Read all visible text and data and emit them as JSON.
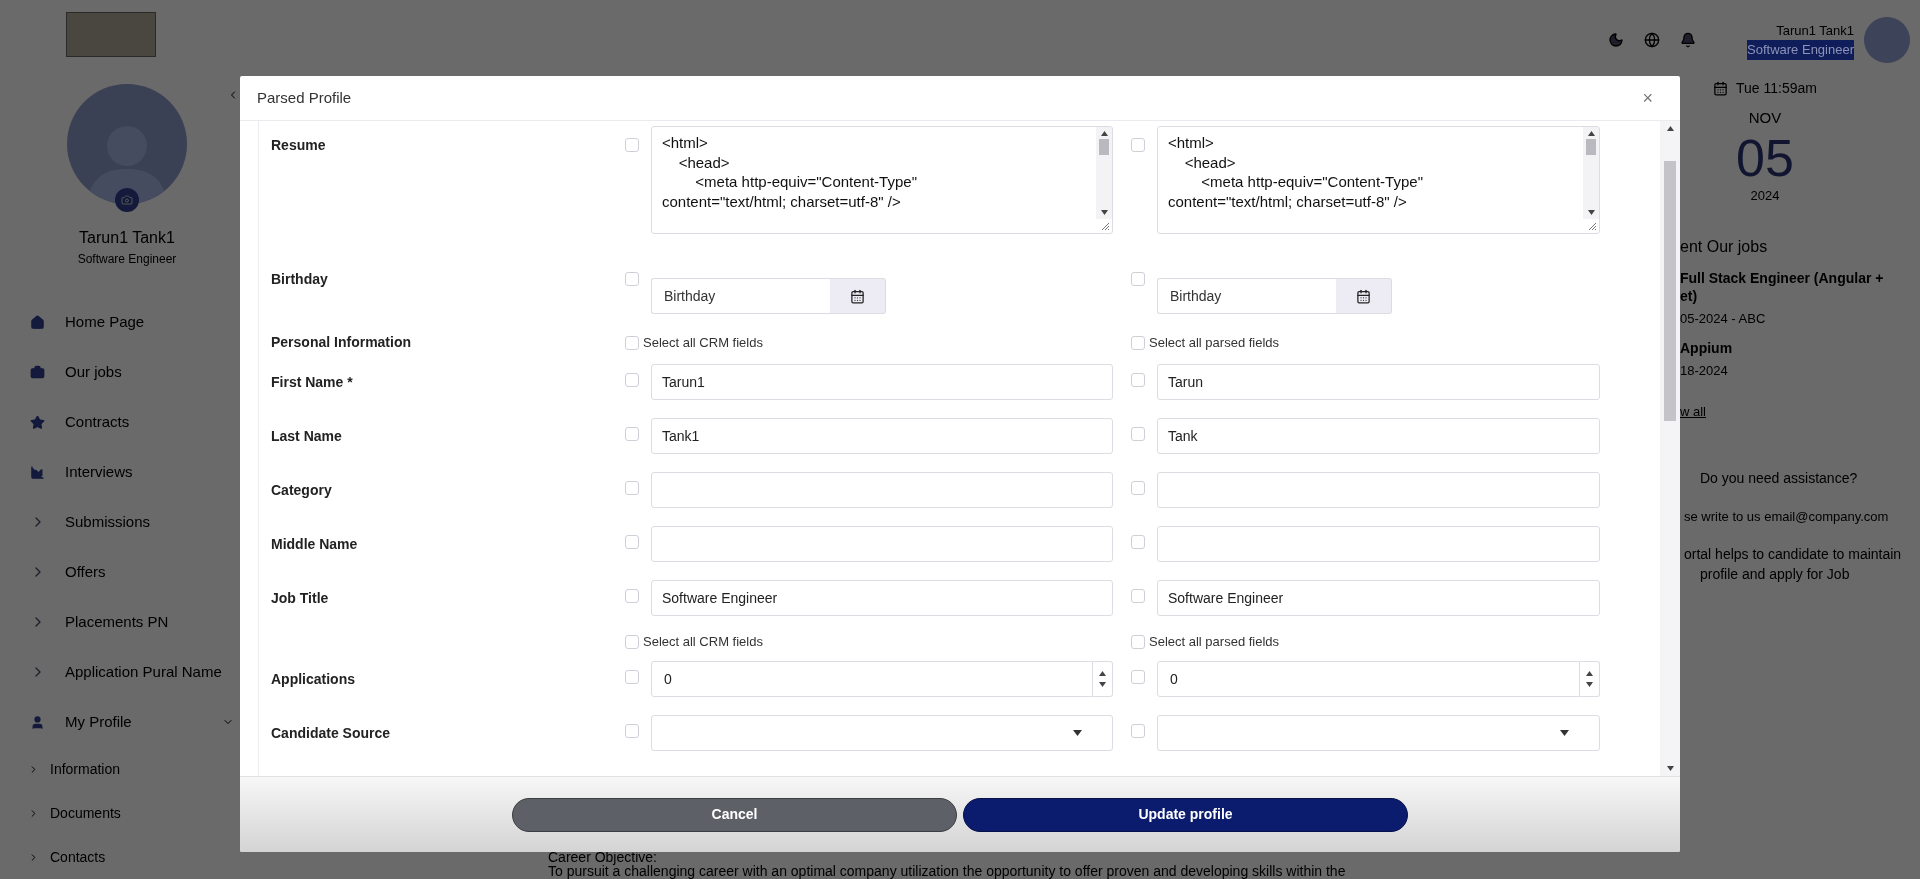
{
  "sidebar": {
    "user_name": "Tarun1 Tank1",
    "user_title": "Software Engineer",
    "items": [
      {
        "label": "Home Page",
        "kind": "link"
      },
      {
        "label": "Our jobs",
        "kind": "link"
      },
      {
        "label": "Contracts",
        "kind": "link"
      },
      {
        "label": "Interviews",
        "kind": "link"
      },
      {
        "label": "Submissions",
        "kind": "group",
        "expanded": false
      },
      {
        "label": "Offers",
        "kind": "group",
        "expanded": false
      },
      {
        "label": "Placements PN",
        "kind": "group",
        "expanded": false
      },
      {
        "label": "Application Pural Name",
        "kind": "group",
        "expanded": false
      },
      {
        "label": "My Profile",
        "kind": "section",
        "expanded": true,
        "children": [
          {
            "label": "Information"
          },
          {
            "label": "Documents"
          },
          {
            "label": "Contacts"
          }
        ]
      }
    ]
  },
  "topbar": {
    "user_name": "Tarun1 Tank1",
    "user_title": "Software Engineer",
    "title_highlighted": true
  },
  "date": {
    "time": "Tue 11:59am",
    "month": "NOV",
    "day": "05",
    "year": "2024"
  },
  "recent_jobs": {
    "heading": "ent Our jobs",
    "jobs": [
      {
        "title_lines": [
          "Full Stack Engineer (Angular +",
          "et)"
        ],
        "meta": "05-2024 - ABC"
      },
      {
        "title_lines": [
          "Appium"
        ],
        "meta": "18-2024"
      }
    ],
    "link": "w all"
  },
  "assistance": {
    "heading": "Do you need assistance?",
    "contact": "se write to us email@company.com",
    "lines": [
      "ortal helps to candidate to maintain",
      "profile and apply for Job"
    ]
  },
  "main": {
    "heading": "Career Objective:",
    "paragraph": "To pursuit a challenging career with an optimal company utilization the opportunity to offer proven and developing skills within the"
  },
  "modal": {
    "title": "Parsed Profile",
    "close": "×",
    "rows": [
      {
        "kind": "textarea",
        "label": "Resume",
        "crm": {
          "checked": false,
          "value": "<html>\n\t<head>\n\t\t<meta http-equiv=\"Content-Type\"\ncontent=\"text/html; charset=utf-8\" />"
        },
        "parsed": {
          "checked": false,
          "value": "<html>\n\t<head>\n\t\t<meta http-equiv=\"Content-Type\"\ncontent=\"text/html; charset=utf-8\" />"
        }
      },
      {
        "kind": "date",
        "label": "Birthday",
        "crm": {
          "checked": false,
          "placeholder": "Birthday"
        },
        "parsed": {
          "checked": false,
          "placeholder": "Birthday"
        }
      },
      {
        "kind": "select_all",
        "label": "Personal Information",
        "crm": {
          "checked": false,
          "text": "Select all CRM fields"
        },
        "parsed": {
          "checked": false,
          "text": "Select all parsed fields"
        }
      },
      {
        "kind": "text",
        "label": "First Name *",
        "crm": {
          "checked": false,
          "value": "Tarun1"
        },
        "parsed": {
          "checked": false,
          "value": "Tarun"
        }
      },
      {
        "kind": "text",
        "label": "Last Name",
        "crm": {
          "checked": false,
          "value": "Tank1"
        },
        "parsed": {
          "checked": false,
          "value": "Tank"
        }
      },
      {
        "kind": "text",
        "label": "Category",
        "crm": {
          "checked": false
        },
        "parsed": {
          "checked": false
        }
      },
      {
        "kind": "text",
        "label": "Middle Name",
        "crm": {
          "checked": false
        },
        "parsed": {
          "checked": false
        }
      },
      {
        "kind": "text",
        "label": "Job Title",
        "crm": {
          "checked": false,
          "value": "Software Engineer"
        },
        "parsed": {
          "checked": false,
          "value": "Software Engineer"
        }
      },
      {
        "kind": "select_all",
        "crm": {
          "checked": false,
          "text": "Select all CRM fields"
        },
        "parsed": {
          "checked": false,
          "text": "Select all parsed fields"
        }
      },
      {
        "kind": "number",
        "label": "Applications",
        "crm": {
          "checked": false,
          "value": "0"
        },
        "parsed": {
          "checked": false,
          "value": "0"
        }
      },
      {
        "kind": "select",
        "label": "Candidate Source",
        "crm": {
          "checked": false
        },
        "parsed": {
          "checked": false
        }
      }
    ],
    "buttons": [
      {
        "label": "Cancel",
        "kind": "secondary"
      },
      {
        "label": "Update profile",
        "kind": "primary"
      }
    ]
  }
}
